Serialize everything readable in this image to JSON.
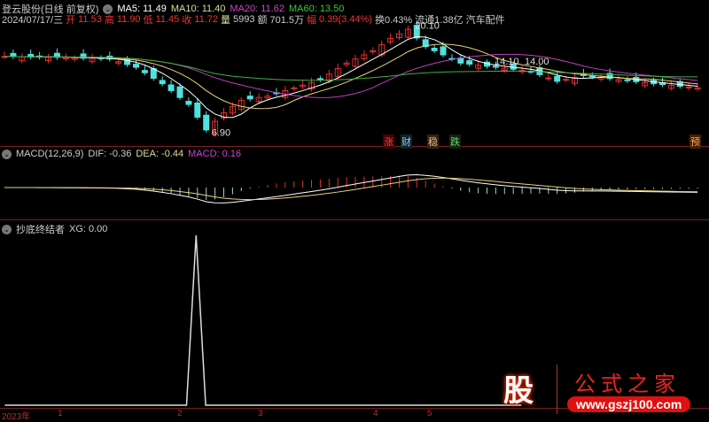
{
  "header": {
    "title": "登云股份(日线 前复权)",
    "ma5": "MA5: 11.49",
    "ma10": "MA10: 11.40",
    "ma20": "MA20: 11.62",
    "ma60": "MA60: 13.50"
  },
  "quote": {
    "date": "2024/07/17/三",
    "open_l": "开",
    "open": "11.53",
    "high_l": "高",
    "high": "11.90",
    "low_l": "低",
    "low": "11.45",
    "close_l": "收",
    "close": "11.72",
    "vol_l": "量",
    "vol": "5993",
    "amt_l": "额",
    "amt": "701.5万",
    "chg_l": "幅",
    "chg": "0.39(3.44%)",
    "turn": "换0.43%",
    "float": "流通1.38亿",
    "industry": "汽车配件"
  },
  "macd": {
    "title": "MACD(12,26,9)",
    "dif": "DIF: -0.36",
    "dea": "DEA: -0.44",
    "macd": "MACD: 0.16"
  },
  "xg": {
    "title": "抄底终结者",
    "value": "XG: 0.00"
  },
  "markers": [
    "涨",
    "财",
    "稳",
    "跌",
    "预"
  ],
  "axis": {
    "labels": [
      "2023年",
      "1",
      "2",
      "3",
      "4",
      "5"
    ]
  },
  "logo": {
    "char": "股",
    "name": "公式之家",
    "url": "www.gszj100.com"
  },
  "colors": {
    "up": "#e03030",
    "down": "#50e0e0",
    "ma5": "#ffffff",
    "ma10": "#e8d27a",
    "ma20": "#c040c0",
    "ma60": "#40b040"
  },
  "chart_data": {
    "type": "candlestick",
    "bars": 80,
    "close_keypoints": [
      [
        0,
        16.3
      ],
      [
        6,
        16.2
      ],
      [
        12,
        16.0
      ],
      [
        15,
        15.0
      ],
      [
        18,
        13.0
      ],
      [
        21,
        10.5
      ],
      [
        23,
        7.4
      ],
      [
        25,
        9.5
      ],
      [
        27,
        11.0
      ],
      [
        30,
        11.5
      ],
      [
        33,
        12.5
      ],
      [
        36,
        13.5
      ],
      [
        39,
        15.5
      ],
      [
        42,
        17.0
      ],
      [
        44,
        18.5
      ],
      [
        46,
        19.6
      ],
      [
        48,
        17.5
      ],
      [
        50,
        16.5
      ],
      [
        52,
        15.5
      ],
      [
        56,
        15.0
      ],
      [
        60,
        14.5
      ],
      [
        63,
        13.3
      ],
      [
        66,
        14.0
      ],
      [
        70,
        13.5
      ],
      [
        74,
        13.0
      ],
      [
        79,
        12.5
      ]
    ],
    "high_label": "20.10",
    "low_label": "6.90",
    "mid_labels": [
      "14.10",
      "14.00"
    ],
    "price_range": [
      6,
      21
    ],
    "xg_signal_bar": 20
  }
}
